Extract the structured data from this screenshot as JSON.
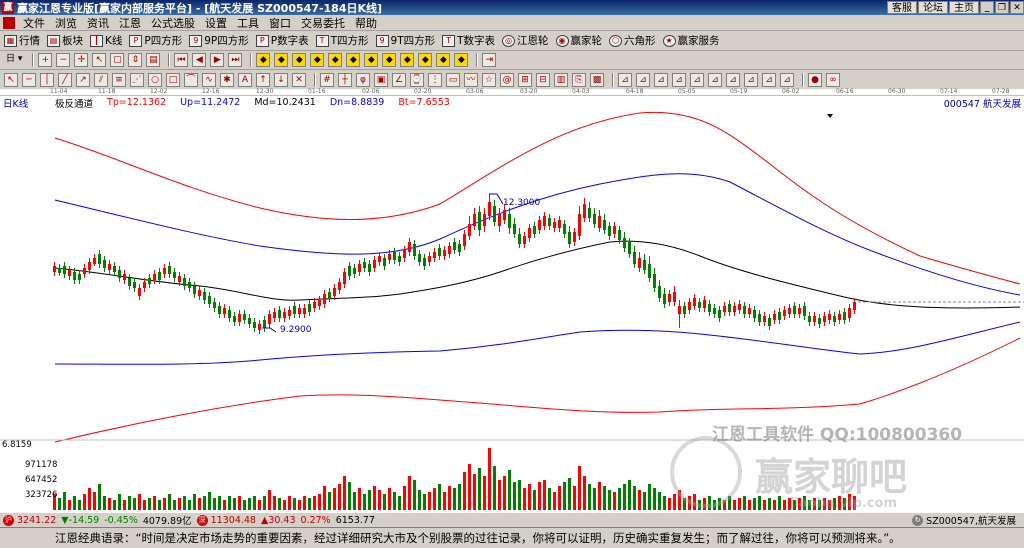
{
  "window": {
    "title": "赢家江恩专业版[赢家内部服务平台] - [航天发展   SZ000547-184日K线]",
    "links": [
      "客服",
      "论坛",
      "主页"
    ]
  },
  "menu": [
    "文件",
    "浏览",
    "资讯",
    "江恩",
    "公式选股",
    "设置",
    "工具",
    "窗口",
    "交易委托",
    "帮助"
  ],
  "toolbar1": [
    {
      "icon": "grid-icon",
      "label": "行情"
    },
    {
      "icon": "sector-icon",
      "label": "板块"
    },
    {
      "icon": "kline-icon",
      "label": "K线"
    },
    {
      "icon": "p-square-icon",
      "label": "P四方形"
    },
    {
      "icon": "9p-square-icon",
      "label": "9P四方形"
    },
    {
      "icon": "p-number-icon",
      "label": "P数字表"
    },
    {
      "icon": "t-square-icon",
      "label": "T四方形"
    },
    {
      "icon": "9t-square-icon",
      "label": "9T四方形"
    },
    {
      "icon": "t-number-icon",
      "label": "T数字表"
    },
    {
      "icon": "gann-wheel-icon",
      "label": "江恩轮"
    },
    {
      "icon": "winner-wheel-icon",
      "label": "赢家轮"
    },
    {
      "icon": "hexagon-icon",
      "label": "六角形"
    },
    {
      "icon": "service-icon",
      "label": "赢家服务"
    }
  ],
  "info": {
    "period": "日K线",
    "indicator": "极反通道",
    "tp": "Tp=12.1362",
    "up": "Up=11.2472",
    "md": "Md=10.2431",
    "dn": "Dn=8.8839",
    "bt": "Bt=7.6553",
    "stock": "000547  航天发展"
  },
  "dates": [
    "11-04",
    "11-18",
    "12-02",
    "12-16",
    "12-30",
    "01-16",
    "02-06",
    "02-20",
    "03-06",
    "03-20",
    "04-03",
    "04-18",
    "05-05",
    "05-19",
    "06-02",
    "06-16",
    "06-30",
    "07-14",
    "07-28"
  ],
  "annotations": {
    "high": "12.3000",
    "low": "9.2900"
  },
  "volume_axis": [
    "6.8159",
    "971178",
    "647452",
    "323726"
  ],
  "status": {
    "sh_index": "3241.22",
    "sh_change": "▼-14.59",
    "sh_pct": "-0.45%",
    "sh_amount": "4079.89亿",
    "sz_index": "11304.48",
    "sz_change": "▲30.43",
    "sz_pct": "0.27%",
    "sz_amount": "6153.77",
    "current": "SZ000547,航天发展"
  },
  "watermark": {
    "line1": "江恩工具软件  QQ:100800360",
    "line2": "赢家聊吧",
    "line3": "jiaoba.vip.com"
  },
  "quote": "江恩经典语录：“时间是决定市场走势的重要因素，经过详细研究大市及个别股票的过往记录，你将可以证明，历史确实重复发生；而了解过往，你将可以预测将来。”。",
  "colors": {
    "up_candle": "#ff0000",
    "down_candle": "#008000",
    "outer_band": "#ff0000",
    "inner_band": "#0000ff",
    "middle_line": "#000000"
  }
}
